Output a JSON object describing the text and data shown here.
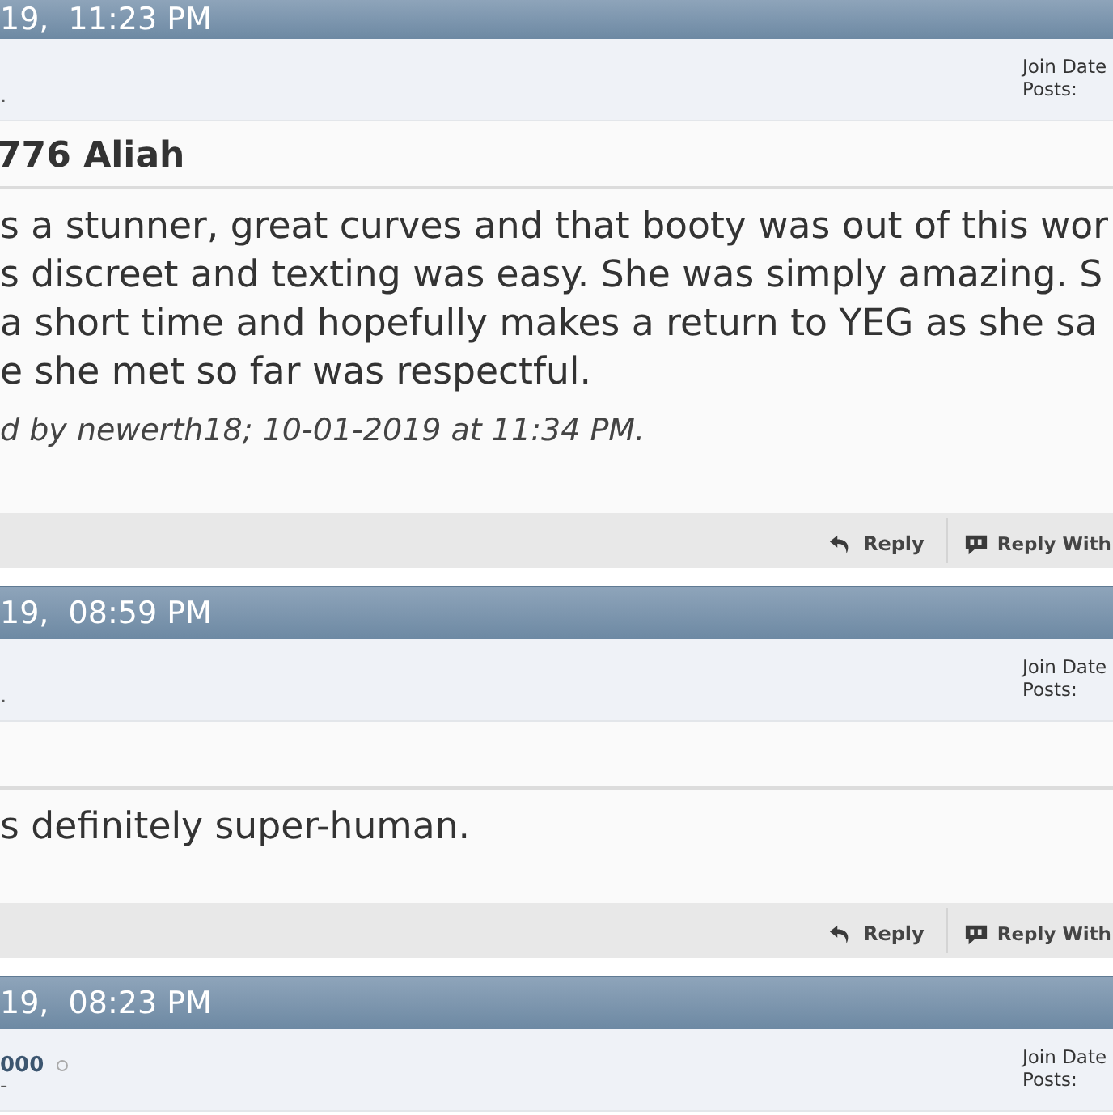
{
  "posts": [
    {
      "time": "19,  11:23 PM",
      "user": {
        "line": "."
      },
      "join_label": "Join Date",
      "posts_label": "Posts:",
      "title": "776 Aliah",
      "body_lines": [
        "s a stunner, great curves and that booty was out of this wor",
        "s discreet and texting was easy. She was simply amazing. S",
        "a short time and hopefully makes a return to YEG as she sa",
        "e she met so far was respectful."
      ],
      "edit_note": "d by newerth18; 10-01-2019 at 11:34 PM.",
      "actions": [
        {
          "kind": "reply",
          "label": "Reply"
        },
        {
          "kind": "quote",
          "label": "Reply With"
        }
      ]
    },
    {
      "time": "19,  08:59 PM",
      "user": {
        "line": "."
      },
      "join_label": "Join Date",
      "posts_label": "Posts:",
      "body_lines": [
        "s definitely super-human."
      ],
      "actions": [
        {
          "kind": "reply",
          "label": "Reply"
        },
        {
          "kind": "quote",
          "label": "Reply With"
        }
      ]
    },
    {
      "time": "19,  08:23 PM",
      "user": {
        "name": "000",
        "line": "-"
      },
      "join_label": "Join Date",
      "posts_label": "Posts:"
    }
  ]
}
